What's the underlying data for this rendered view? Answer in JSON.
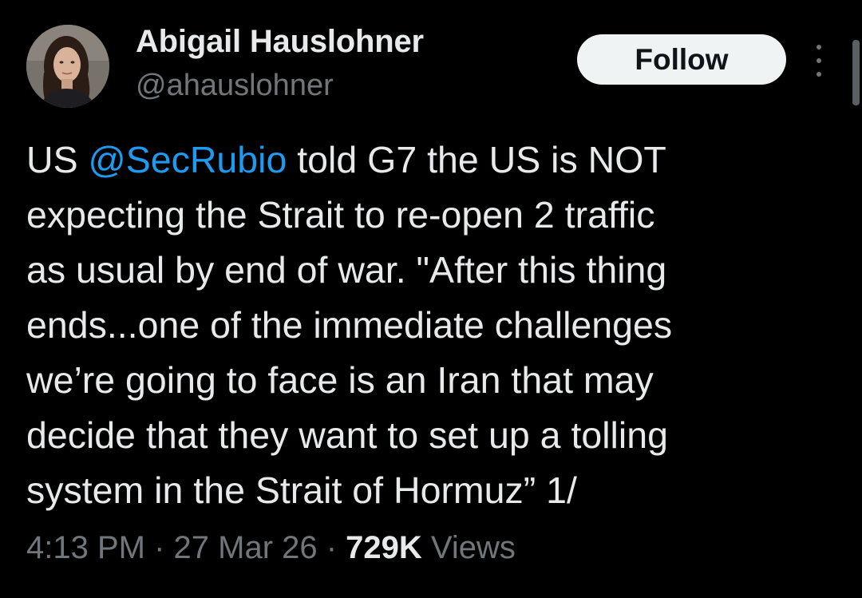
{
  "author": {
    "name": "Abigail Hauslohner",
    "handle": "@ahauslohner"
  },
  "actions": {
    "follow_label": "Follow",
    "more_icon": "more-vertical-icon"
  },
  "tweet": {
    "lines": [
      {
        "before": "US ",
        "mention": "@SecRubio",
        "after": " told G7 the US is NOT"
      },
      {
        "text": "expecting the Strait to re-open 2 traffic"
      },
      {
        "text": "as usual by end of war. \"After this thing"
      },
      {
        "text": "ends...one of the immediate challenges"
      },
      {
        "text": "we’re going to face is an Iran that may"
      },
      {
        "text": "decide that they want to set up a tolling"
      },
      {
        "text": "system in the Strait of Hormuz” 1/"
      }
    ]
  },
  "meta": {
    "time": "4:13 PM",
    "separator": " · ",
    "date": "27 Mar 26",
    "views_count": "729K",
    "views_label": " Views"
  },
  "colors": {
    "background": "#000000",
    "text": "#e7e9ea",
    "secondary": "#71767b",
    "link": "#1d9bf0",
    "button_bg": "#eff3f4",
    "button_text": "#0f1419"
  }
}
